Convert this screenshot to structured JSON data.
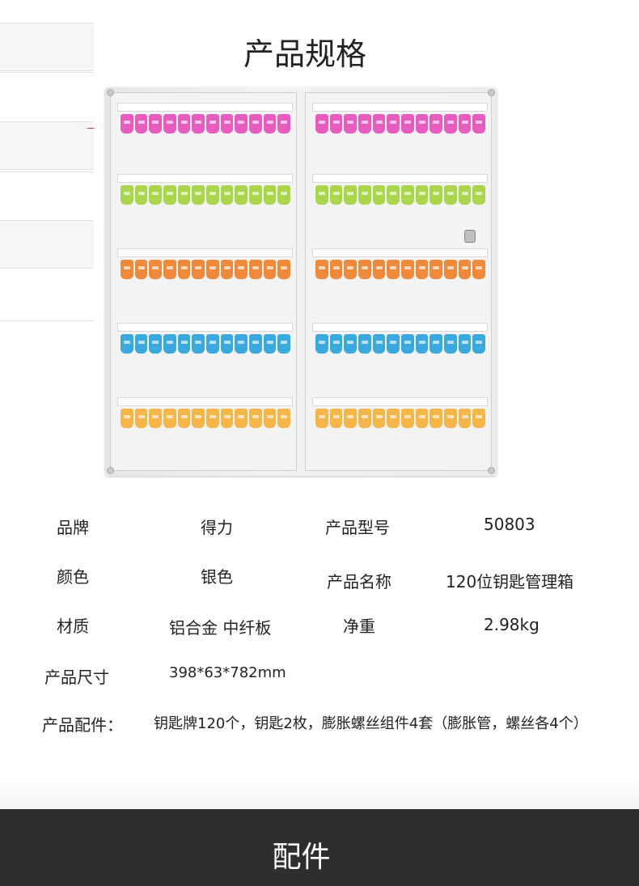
{
  "title": "产品规格",
  "tag_colors": {
    "row1": "#e85cc0",
    "row2": "#a9d64a",
    "row3": "#f08a3a",
    "row4": "#3aa9e0",
    "row5": "#f5b547"
  },
  "specs": {
    "brand_label": "品牌",
    "brand_value": "得力",
    "model_label": "产品型号",
    "model_value": "50803",
    "color_label": "颜色",
    "color_value": "银色",
    "name_label": "产品名称",
    "name_value": "120位钥匙管理箱",
    "material_label": "材质",
    "material_value": "铝合金 中纤板",
    "weight_label": "净重",
    "weight_value": "2.98kg",
    "size_label": "产品尺寸",
    "size_value": "398*63*782mm",
    "accessories_label": "产品配件：",
    "accessories_value": "钥匙牌120个，钥匙2枚，膨胀螺丝组件4套（膨胀管，螺丝各4个）"
  },
  "footer": {
    "label": "配件",
    "background": "#2e2e2e"
  }
}
